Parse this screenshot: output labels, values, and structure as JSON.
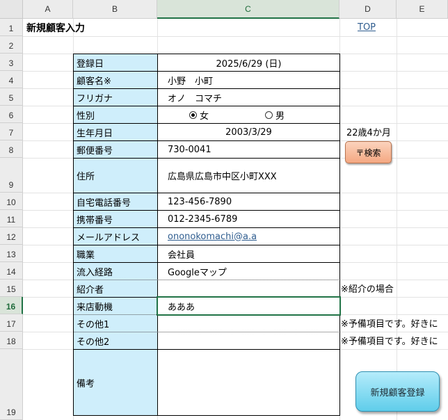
{
  "columns": [
    "A",
    "B",
    "C",
    "D",
    "E"
  ],
  "rows": [
    "1",
    "2",
    "3",
    "4",
    "5",
    "6",
    "7",
    "8",
    "9",
    "10",
    "11",
    "12",
    "13",
    "14",
    "15",
    "16",
    "17",
    "18",
    "19"
  ],
  "header": {
    "title": "新規顧客入力",
    "top_link": "TOP"
  },
  "form": {
    "labels": {
      "reg_date": "登録日",
      "name": "顧客名※",
      "kana": "フリガナ",
      "gender": "性別",
      "birthday": "生年月日",
      "zip": "郵便番号",
      "address": "住所",
      "home_phone": "自宅電話番号",
      "mobile": "携帯番号",
      "email": "メールアドレス",
      "job": "職業",
      "channel": "流入経路",
      "referrer": "紹介者",
      "motive": "来店動機",
      "other1": "その他1",
      "other2": "その他2",
      "notes": "備考"
    },
    "values": {
      "reg_date": "2025/6/29 (日)",
      "name": "小野　小町",
      "kana": "オノ　コマチ",
      "gender_female": "女",
      "gender_male": "男",
      "gender_selected": "女",
      "birthday": "2003/3/29",
      "zip": "730-0041",
      "address": "広島県広島市中区小町XXX",
      "home_phone": "123-456-7890",
      "mobile": "012-2345-6789",
      "email": "ononokomachi@a.a",
      "job": "会社員",
      "channel": "Googleマップ",
      "referrer": "",
      "motive": "あああ",
      "other1": "",
      "other2": "",
      "notes": ""
    },
    "side_notes": {
      "age": "22歳4か月",
      "referrer_note": "※紹介の場合",
      "other1_note": "※予備項目です。好きに",
      "other2_note": "※予備項目です。好きに"
    }
  },
  "buttons": {
    "zip_search": "〒検索",
    "register": "新規顧客登録"
  },
  "selected_cell": "C16"
}
